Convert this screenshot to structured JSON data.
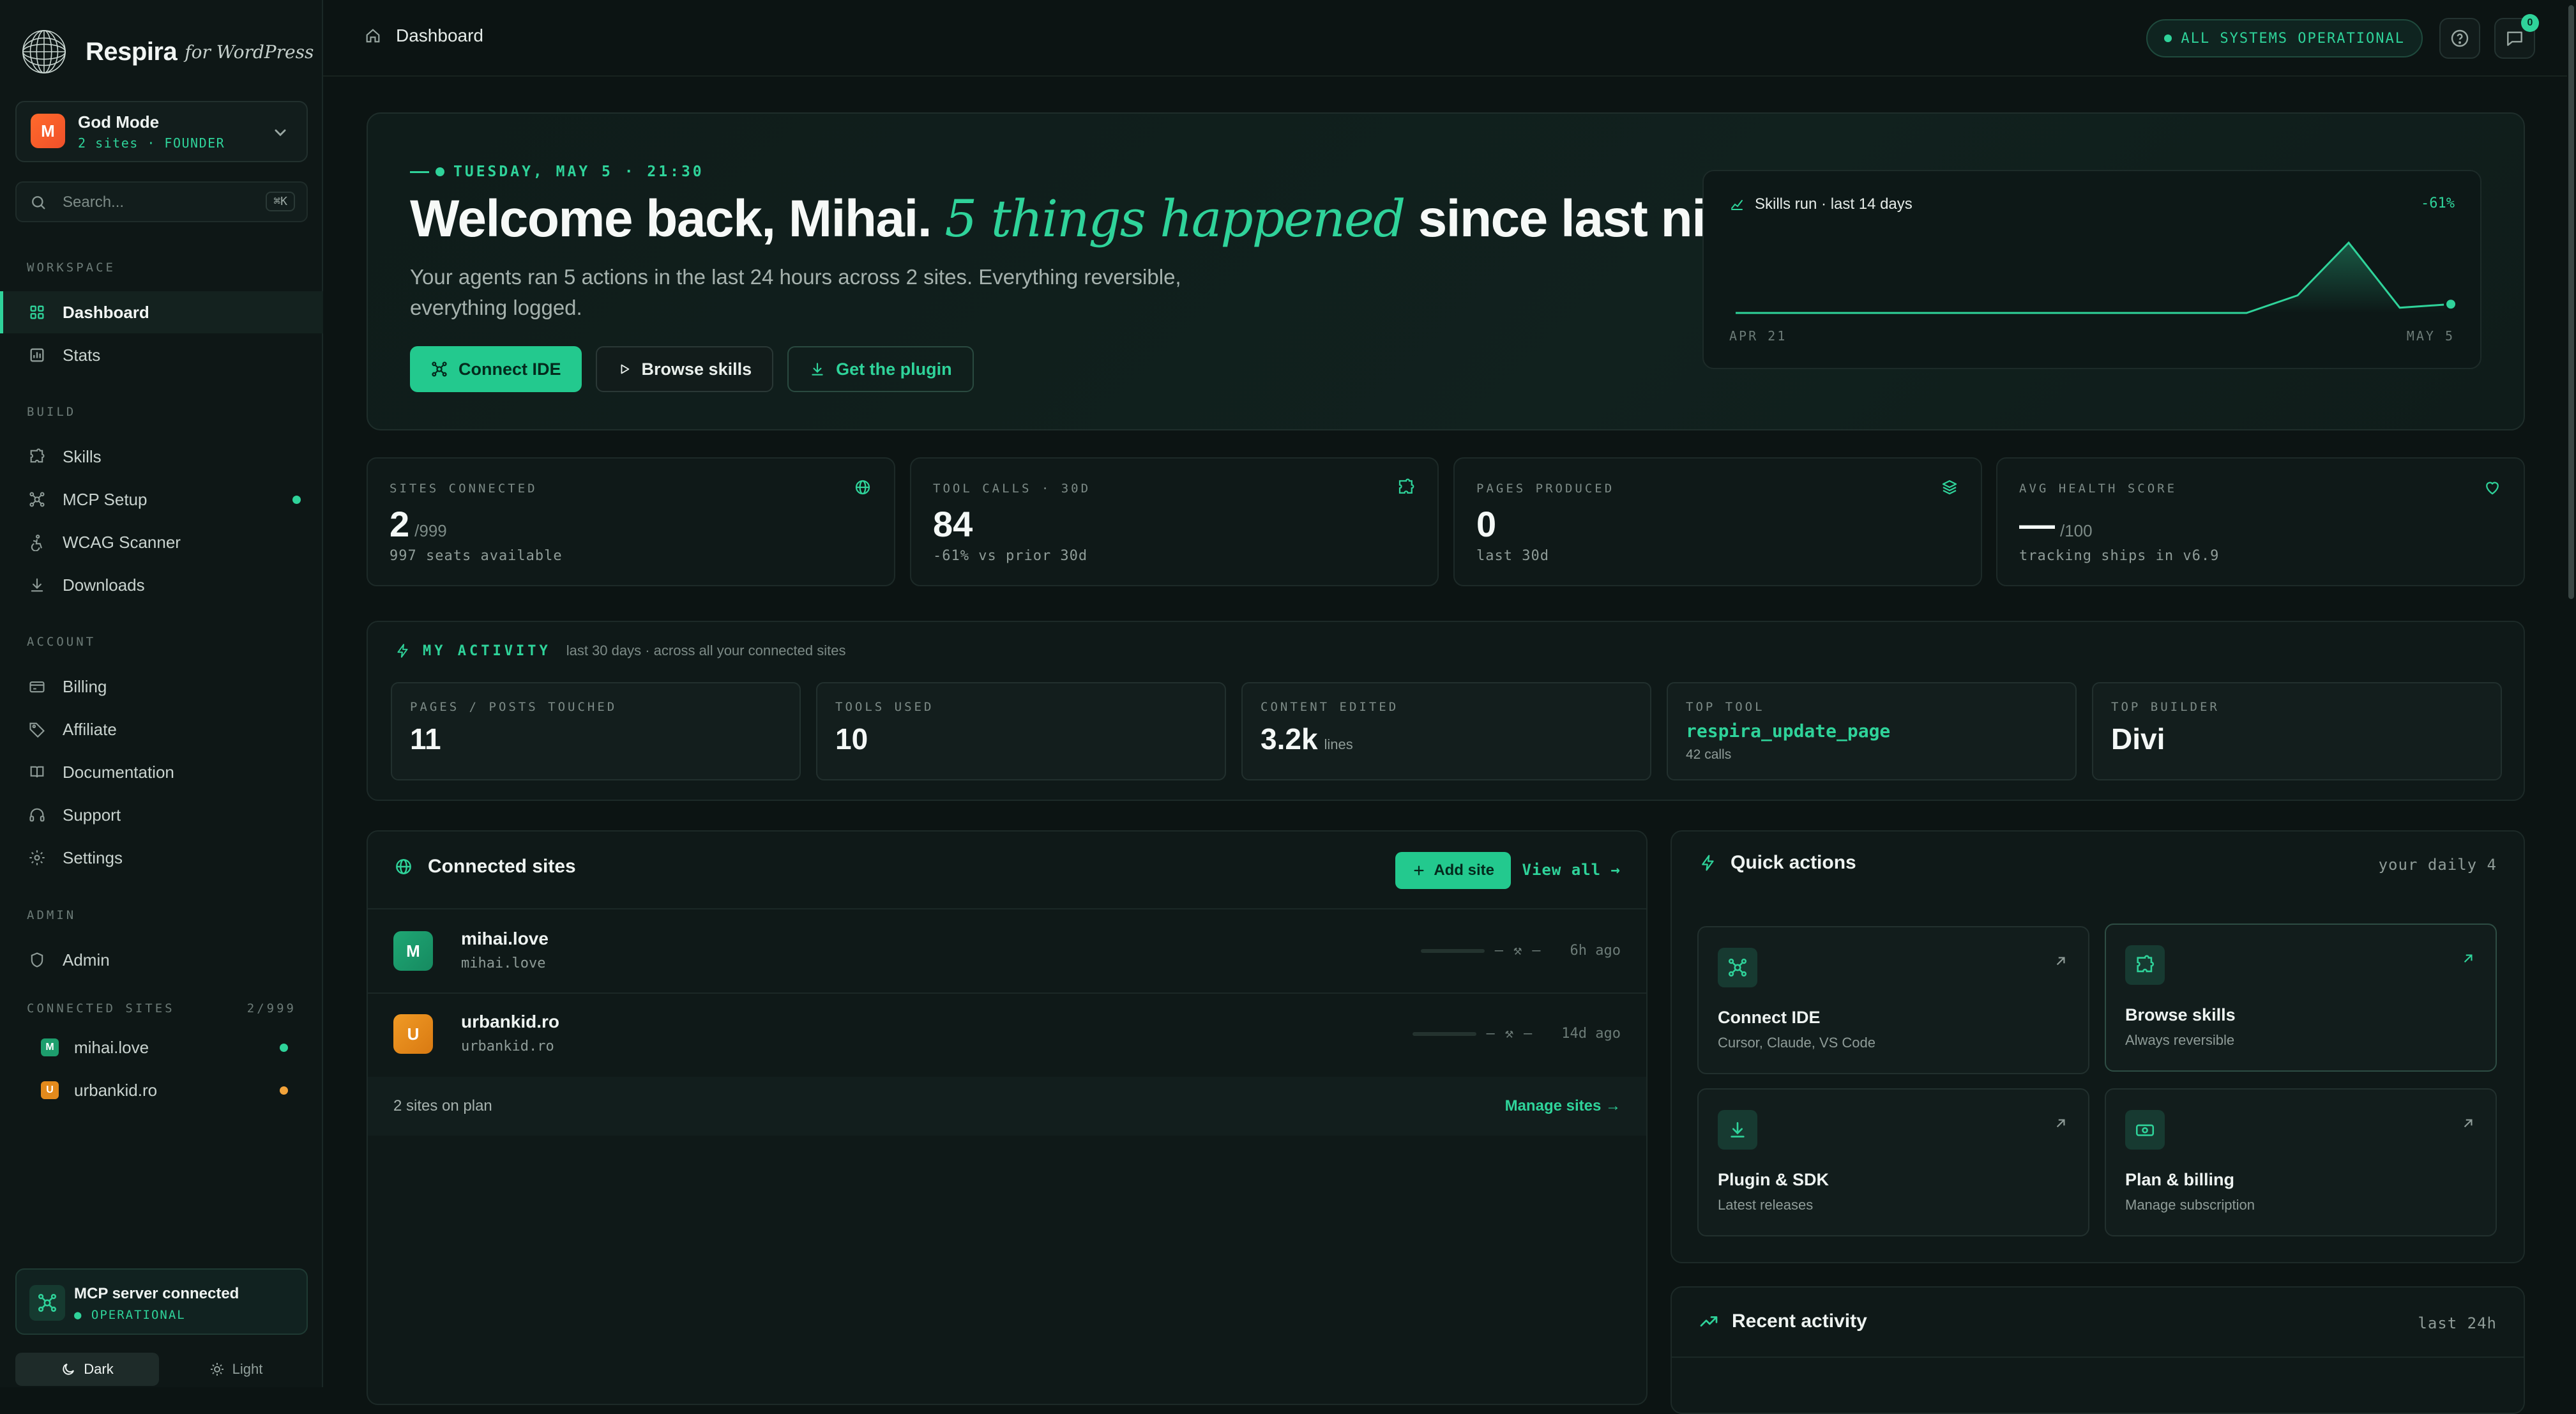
{
  "brand": {
    "name": "Respira",
    "suffix": "for WordPress"
  },
  "workspace": {
    "avatar": "M",
    "name": "God Mode",
    "meta": "2 sites · FOUNDER"
  },
  "search": {
    "placeholder": "Search...",
    "shortcut": "⌘K"
  },
  "sidebar": {
    "sections": {
      "workspace": "WORKSPACE",
      "build": "BUILD",
      "account": "ACCOUNT",
      "admin": "ADMIN"
    },
    "items": {
      "dashboard": "Dashboard",
      "stats": "Stats",
      "skills": "Skills",
      "mcp_setup": "MCP Setup",
      "wcag": "WCAG Scanner",
      "downloads": "Downloads",
      "billing": "Billing",
      "affiliate": "Affiliate",
      "documentation": "Documentation",
      "support": "Support",
      "settings": "Settings",
      "admin": "Admin"
    },
    "connected_sites": {
      "label": "CONNECTED SITES",
      "count": "2/999",
      "sites": [
        {
          "initial": "M",
          "name": "mihai.love",
          "status_color": "#2fd39a"
        },
        {
          "initial": "U",
          "name": "urbankid.ro",
          "status_color": "#f2a33a"
        }
      ]
    },
    "mcp": {
      "title": "MCP server connected",
      "status": "OPERATIONAL"
    },
    "theme": {
      "dark": "Dark",
      "light": "Light",
      "selected": "Dark"
    }
  },
  "topbar": {
    "breadcrumb": "Dashboard",
    "status": "ALL SYSTEMS OPERATIONAL",
    "notifications": "0"
  },
  "hero": {
    "date": "TUESDAY, MAY 5 · 21:30",
    "title_start": "Welcome back, Mihai.",
    "title_accent": "5 things happened",
    "title_end": "since last night.",
    "description": "Your agents ran 5 actions in the last 24 hours across 2 sites. Everything reversible, everything logged.",
    "buttons": {
      "connect": "Connect IDE",
      "browse": "Browse skills",
      "plugin": "Get the plugin"
    },
    "sparkline": {
      "title": "Skills run · last 14 days",
      "delta": "-61%",
      "x_start": "APR 21",
      "x_end": "MAY 5"
    }
  },
  "chart_data": {
    "type": "area",
    "title": "Skills run · last 14 days",
    "x_start": "APR 21",
    "x_end": "MAY 5",
    "values": [
      0,
      0,
      0,
      0,
      0,
      0,
      0,
      0,
      0,
      0,
      0,
      1,
      4,
      0.3,
      0.5
    ]
  },
  "stats": [
    {
      "label": "SITES CONNECTED",
      "value": "2",
      "unit": "/999",
      "sub": "997 seats available",
      "icon": "globe-icon"
    },
    {
      "label": "TOOL CALLS · 30D",
      "value": "84",
      "unit": "",
      "sub": "-61% vs prior 30d",
      "icon": "puzzle-icon"
    },
    {
      "label": "PAGES PRODUCED",
      "value": "0",
      "unit": "",
      "sub": "last 30d",
      "icon": "layers-icon"
    },
    {
      "label": "AVG HEALTH SCORE",
      "value": "—",
      "unit": "/100",
      "sub": "tracking ships in v6.9",
      "icon": "heart-icon"
    }
  ],
  "activity": {
    "title": "MY ACTIVITY",
    "note": "last 30 days · across all your connected sites",
    "cards": [
      {
        "label": "PAGES / POSTS TOUCHED",
        "value": "11",
        "unit": ""
      },
      {
        "label": "TOOLS USED",
        "value": "10",
        "unit": ""
      },
      {
        "label": "CONTENT EDITED",
        "value": "3.2k",
        "unit": "lines"
      },
      {
        "label": "TOP TOOL",
        "value": "respira_update_page",
        "unit": "42 calls"
      },
      {
        "label": "TOP BUILDER",
        "value": "Divi",
        "unit": ""
      }
    ]
  },
  "sites": {
    "title": "Connected sites",
    "add": "Add site",
    "view_all": "View all →",
    "rows": [
      {
        "initial": "M",
        "name": "mihai.love",
        "url": "mihai.love",
        "dash": "—",
        "tool": "—",
        "time": "6h ago"
      },
      {
        "initial": "U",
        "name": "urbankid.ro",
        "url": "urbankid.ro",
        "dash": "—",
        "tool": "—",
        "time": "14d ago"
      }
    ],
    "footer_left": "2 sites on plan",
    "footer_right": "Manage sites →"
  },
  "quick": {
    "title": "Quick actions",
    "note": "your daily 4",
    "cards": [
      {
        "name": "Connect IDE",
        "sub": "Cursor, Claude, VS Code"
      },
      {
        "name": "Browse skills",
        "sub": "Always reversible"
      },
      {
        "name": "Plugin & SDK",
        "sub": "Latest releases"
      },
      {
        "name": "Plan & billing",
        "sub": "Manage subscription"
      }
    ]
  },
  "recent": {
    "title": "Recent activity",
    "note": "last 24h"
  },
  "colors": {
    "accent": "#2fd39a",
    "background": "#0c1413",
    "warning": "#f2a33a"
  }
}
